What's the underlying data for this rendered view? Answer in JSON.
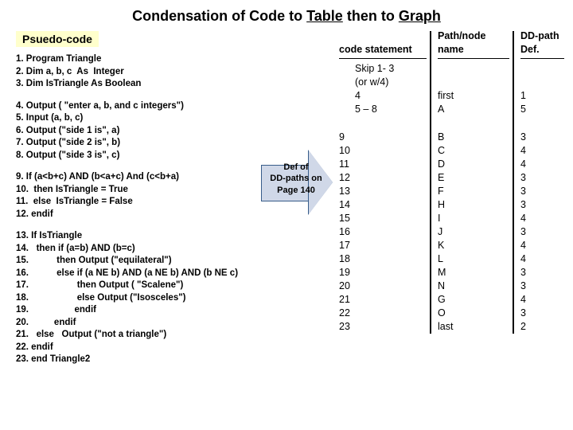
{
  "title": {
    "t1": "Condensation of Code",
    "t2": " to ",
    "t3": "Table",
    "t4": " then to ",
    "t5": "Graph"
  },
  "psuedo_label": "Psuedo-code",
  "code_groups": [
    [
      "1. Program Triangle",
      "2. Dim a, b, c  As  Integer",
      "3. Dim IsTriangle As Boolean"
    ],
    [
      "4. Output ( \"enter a, b, and c integers\")",
      "5. Input (a, b, c)",
      "6. Output (\"side 1 is\", a)",
      "7. Output (\"side 2 is\", b)",
      "8. Output (\"side 3 is\", c)"
    ],
    [
      "9. If (a<b+c) AND (b<a+c) And (c<b+a)",
      "10.  then IsTriangle = True",
      "11.  else  IsTriangle = False",
      "12. endif"
    ],
    [
      "13. If IsTriangle",
      "14.   then if (a=b) AND (b=c)",
      "15.           then Output (\"equilateral\")",
      "16.           else if (a NE b) AND (a NE b) AND (b NE c)",
      "17.                   then Output ( \"Scalene\")",
      "18.                   else Output (\"Isosceles\")",
      "19.                  endif",
      "20.          endif",
      "21.   else   Output (\"not a triangle\")",
      "22. endif",
      "23. end Triangle2"
    ]
  ],
  "arrow": {
    "l1": "Def of",
    "l2": "DD-paths on",
    "l3": "Page 140"
  },
  "cols": {
    "stmt_head": "code statement",
    "path_head": "Path/node name",
    "dd_head": "DD-path Def.",
    "stmt1": [
      "Skip 1- 3",
      "(or w/4)",
      "4",
      "5 – 8"
    ],
    "path1": [
      "",
      "",
      "first",
      "A"
    ],
    "dd1": [
      "",
      "",
      "1",
      "5"
    ],
    "stmt2": [
      "9",
      "10",
      "11",
      "12",
      "13",
      "14",
      "15",
      "16",
      "17",
      "18",
      "19",
      "20",
      "21",
      "22",
      "23"
    ],
    "path2": [
      "B",
      "C",
      "D",
      "E",
      "F",
      "H",
      "I",
      "J",
      "K",
      "L",
      "M",
      "N",
      "G",
      "O",
      "  last"
    ],
    "dd2": [
      "3",
      "4",
      "4",
      "3",
      "3",
      "3",
      "4",
      "3",
      "4",
      "4",
      "3",
      "3",
      "4",
      "3",
      "2"
    ]
  }
}
